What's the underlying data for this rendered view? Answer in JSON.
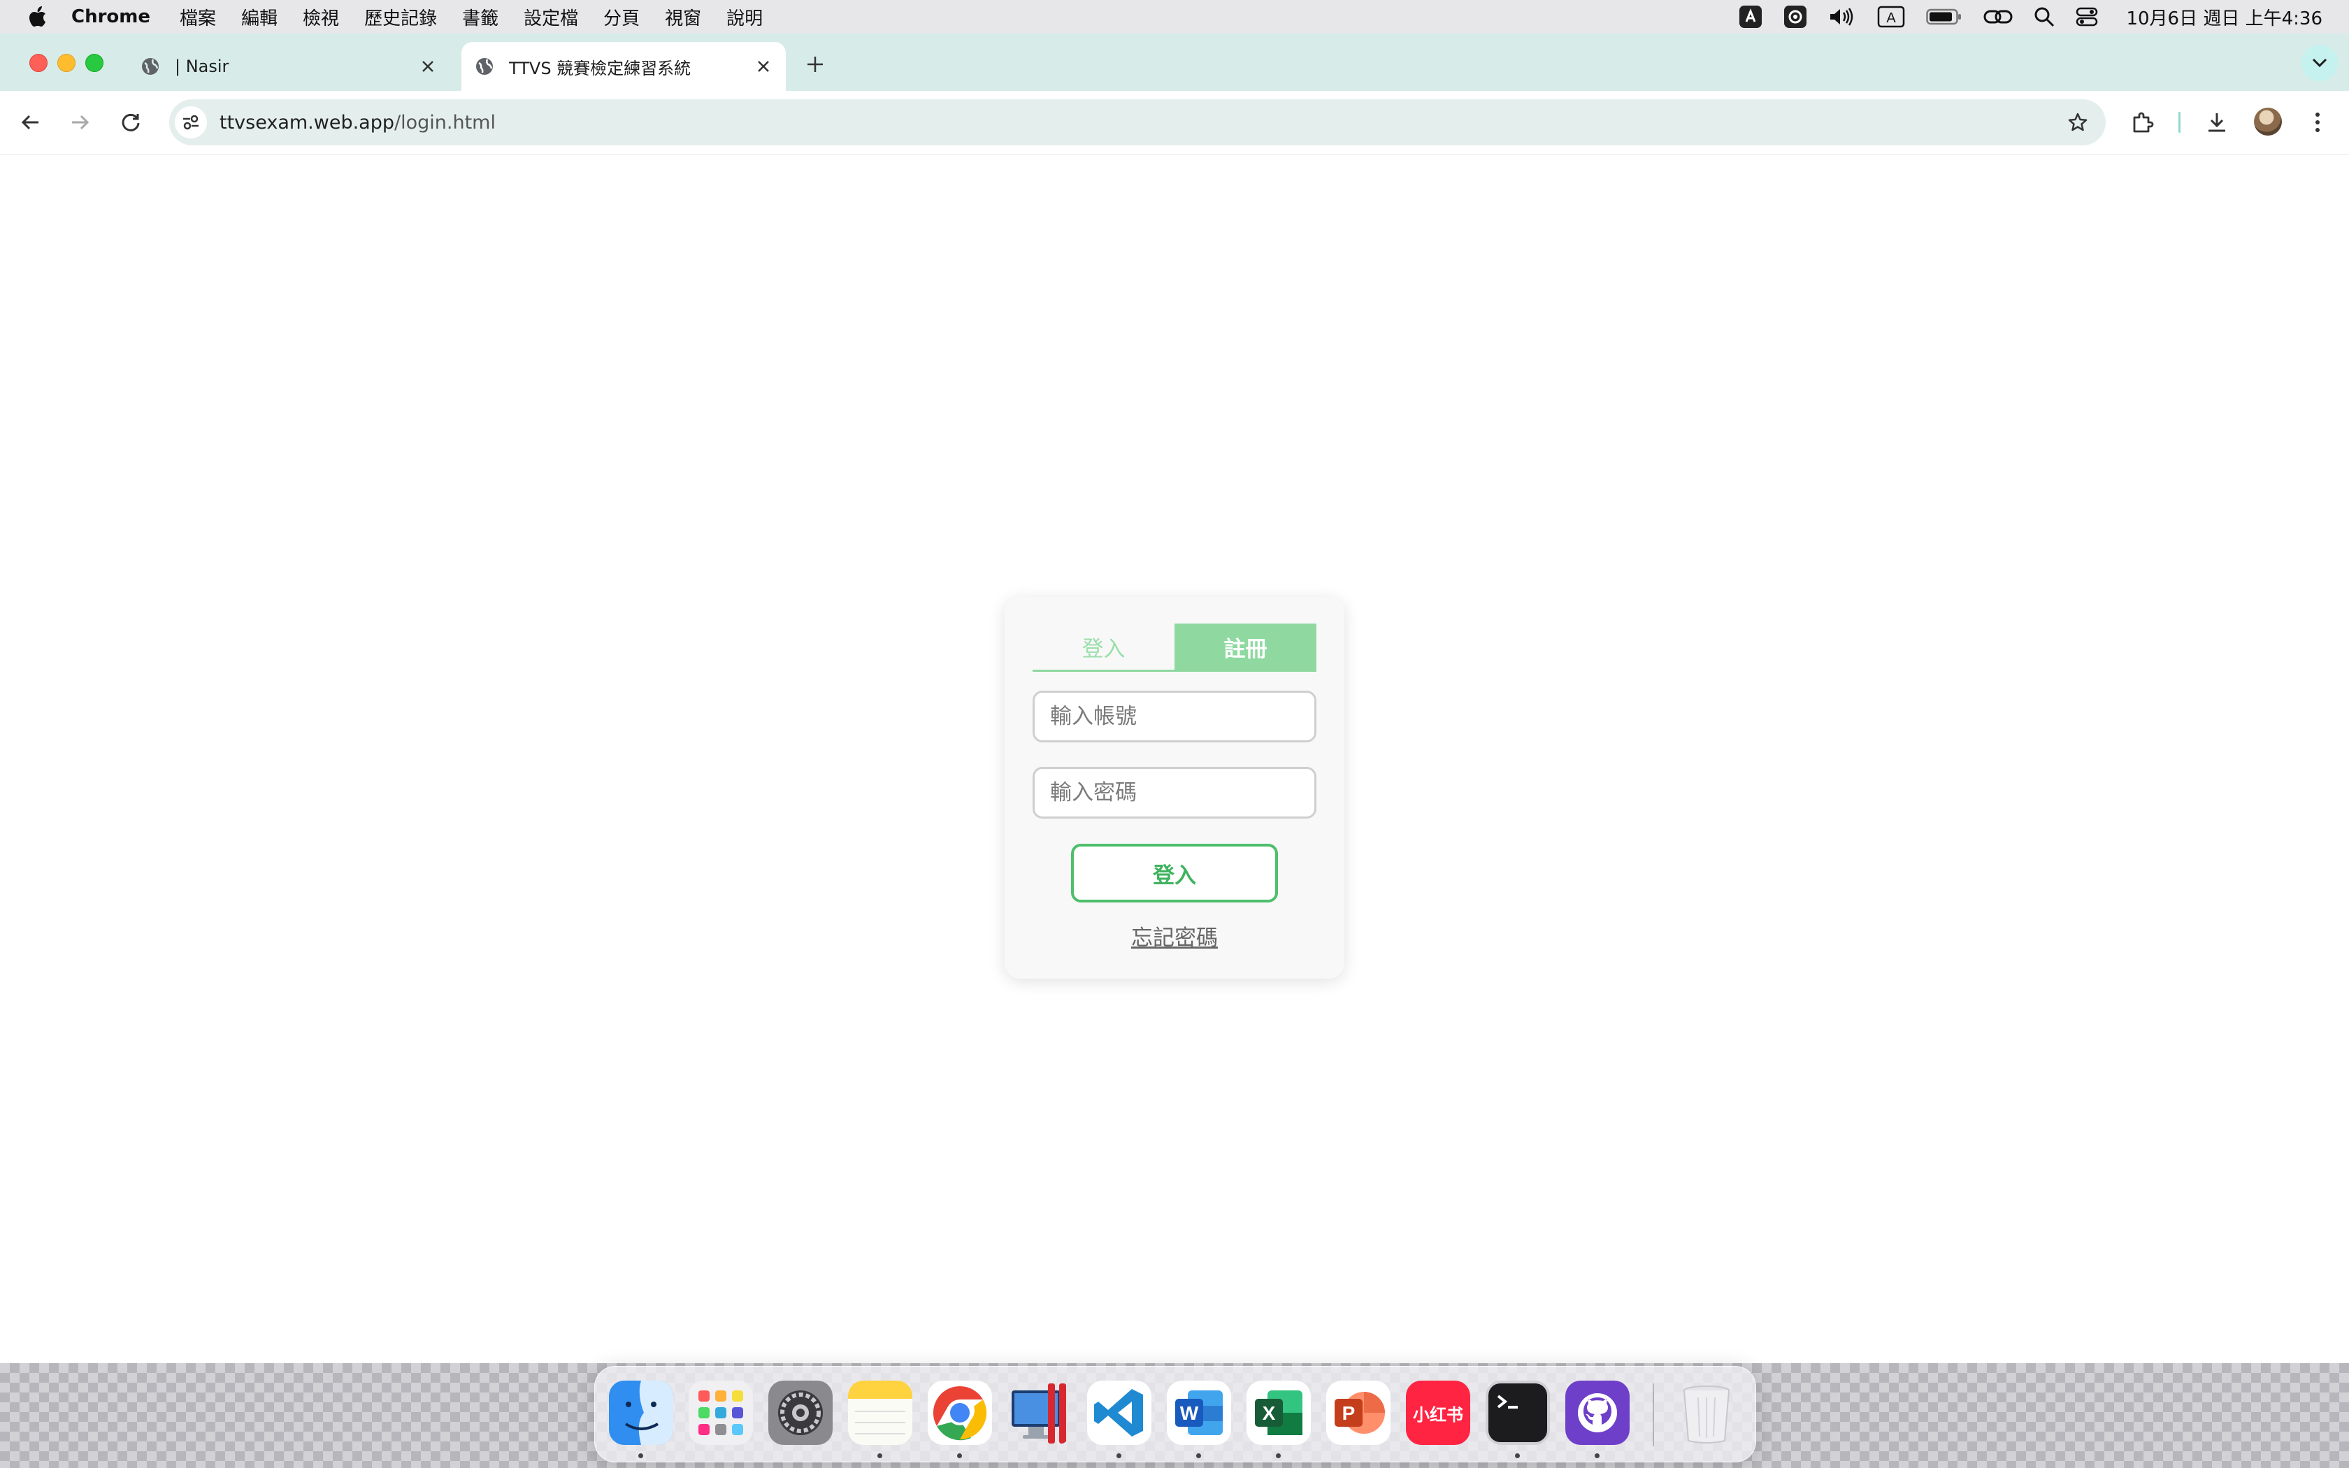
{
  "menubar": {
    "apple_icon": "apple-icon",
    "app_name": "Chrome",
    "items": [
      "檔案",
      "編輯",
      "檢視",
      "歷史記錄",
      "書籤",
      "設定檔",
      "分頁",
      "視窗",
      "說明"
    ],
    "input_source": "A",
    "clock": "10月6日 週日 上午4:36"
  },
  "browser": {
    "tabs": [
      {
        "title": "| Nasir",
        "active": false
      },
      {
        "title": "TTVS 競賽檢定練習系統",
        "active": true
      }
    ],
    "url_host": "ttvsexam.web.app",
    "url_path": "/login.html"
  },
  "login": {
    "tab_login": "登入",
    "tab_register": "註冊",
    "account_placeholder": "輸入帳號",
    "password_placeholder": "輸入密碼",
    "login_button": "登入",
    "forgot_password": "忘記密碼"
  },
  "dock": {
    "apps": [
      "Finder",
      "Launchpad",
      "System Settings",
      "Notes",
      "Google Chrome",
      "Parallels Desktop",
      "Visual Studio Code",
      "Microsoft Word",
      "Microsoft Excel",
      "Microsoft PowerPoint",
      "小红书",
      "Terminal",
      "GitHub Desktop",
      "Trash"
    ],
    "xiaohongshu_label": "小红书",
    "word_letter": "W",
    "excel_letter": "X",
    "powerpoint_letter": "P"
  },
  "colors": {
    "accent_green": "#4ebf6b",
    "tab_green": "#8fd9a0",
    "tabstrip": "#d7ece8"
  }
}
